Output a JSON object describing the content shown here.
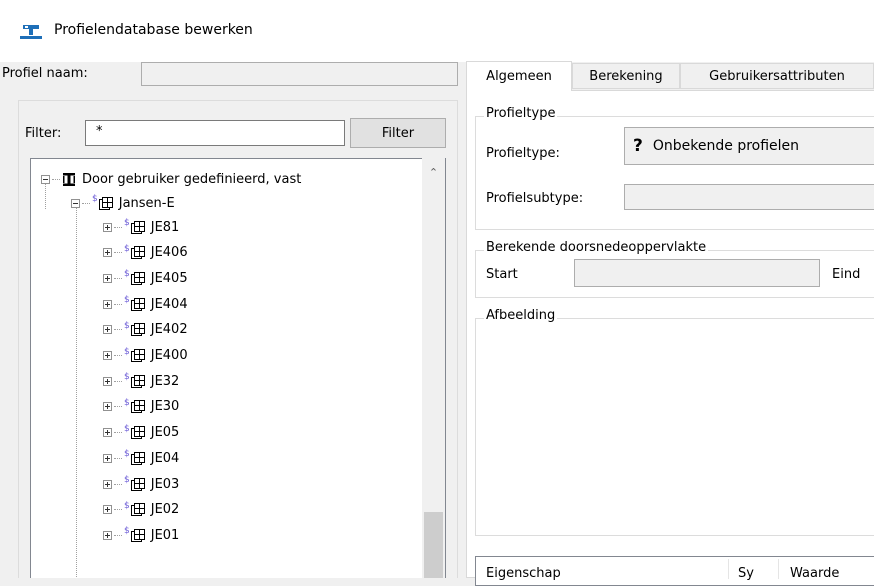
{
  "window": {
    "title": "Profielendatabase bewerken",
    "icon": "database-edit-icon"
  },
  "profile_name": {
    "label": "Profiel naam:",
    "value": ""
  },
  "filter": {
    "label": "Filter:",
    "value": "*",
    "button_label": "Filter"
  },
  "tree": {
    "root": {
      "label": "Door gebruiker gedefinieerd, vast",
      "icon": "i-beam-profile-icon",
      "expanded": true
    },
    "group": {
      "label": "Jansen-E",
      "icon": "profile-family-icon",
      "expanded": true
    },
    "items": [
      {
        "label": "JE81"
      },
      {
        "label": "JE406"
      },
      {
        "label": "JE405"
      },
      {
        "label": "JE404"
      },
      {
        "label": "JE402"
      },
      {
        "label": "JE400"
      },
      {
        "label": "JE32"
      },
      {
        "label": "JE30"
      },
      {
        "label": "JE05"
      },
      {
        "label": "JE04"
      },
      {
        "label": "JE03"
      },
      {
        "label": "JE02"
      },
      {
        "label": "JE01"
      }
    ]
  },
  "tabs": [
    {
      "label": "Algemeen",
      "active": true
    },
    {
      "label": "Berekening",
      "active": false
    },
    {
      "label": "Gebruikersattributen",
      "active": false
    }
  ],
  "algemeen": {
    "profieltype_group": {
      "legend": "Profieltype",
      "type_label": "Profieltype:",
      "type_value": "Onbekende profielen",
      "type_glyph": "?",
      "subtype_label": "Profielsubtype:",
      "subtype_value": ""
    },
    "area_group": {
      "legend": "Berekende doorsnedeoppervlakte",
      "start_label": "Start",
      "start_value": "",
      "end_label": "Eind"
    },
    "image_group": {
      "legend": "Afbeelding"
    },
    "properties_table": {
      "columns": [
        "Eigenschap",
        "Sy",
        "Waarde"
      ]
    }
  },
  "colors": {
    "window_bg": "#f0f0f0",
    "panel_bg": "#ffffff",
    "border": "#adadad",
    "accent_icon": "#1e6fb8"
  }
}
